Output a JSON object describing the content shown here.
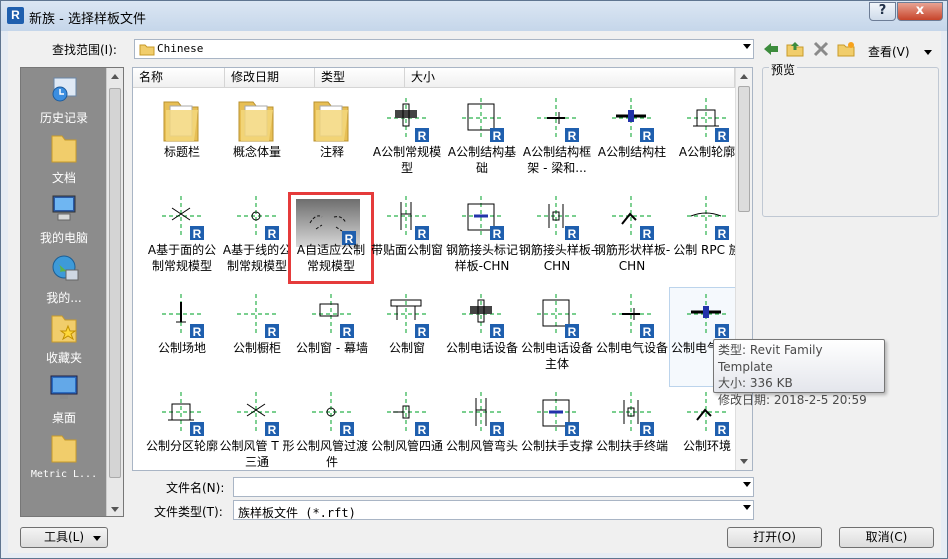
{
  "window": {
    "title": "新族 - 选择样板文件",
    "app_icon": "R",
    "help_label": "?",
    "close_label": "x"
  },
  "lookin": {
    "label": "查找范围(I):",
    "value": "Chinese"
  },
  "toolbar": {
    "views_label": "查看(V)",
    "back_icon": "back-arrow-icon",
    "up_icon": "up-folder-icon",
    "delete_icon": "delete-icon",
    "newfolder_icon": "new-folder-icon"
  },
  "sidebar": {
    "items": [
      {
        "label": "历史记录",
        "icon": "history-icon"
      },
      {
        "label": "文档",
        "icon": "documents-icon"
      },
      {
        "label": "我的电脑",
        "icon": "my-computer-icon"
      },
      {
        "label": "我的...",
        "icon": "network-icon"
      },
      {
        "label": "收藏夹",
        "icon": "favorites-icon"
      },
      {
        "label": "桌面",
        "icon": "desktop-icon"
      },
      {
        "label": "Metric L...",
        "icon": "folder-icon"
      }
    ]
  },
  "columns": [
    "名称",
    "修改日期",
    "类型",
    "大小"
  ],
  "files": [
    {
      "name": "标题栏",
      "kind": "folder"
    },
    {
      "name": "概念体量",
      "kind": "folder"
    },
    {
      "name": "注释",
      "kind": "folder"
    },
    {
      "name": "A公制常规模型",
      "kind": "rft"
    },
    {
      "name": "A公制结构基础",
      "kind": "rft"
    },
    {
      "name": "A公制结构框架 - 梁和...",
      "kind": "rft"
    },
    {
      "name": "A公制结构柱",
      "kind": "rft"
    },
    {
      "name": "A公制轮廓",
      "kind": "rft"
    },
    {
      "name": "A基于面的公制常规模型",
      "kind": "rft"
    },
    {
      "name": "A基于线的公制常规模型",
      "kind": "rft"
    },
    {
      "name": "A自适应公制常规模型",
      "kind": "rft",
      "selected": true
    },
    {
      "name": "带贴面公制窗",
      "kind": "rft"
    },
    {
      "name": "钢筋接头标记样板-CHN",
      "kind": "rft"
    },
    {
      "name": "钢筋接头样板-CHN",
      "kind": "rft"
    },
    {
      "name": "钢筋形状样板-CHN",
      "kind": "rft"
    },
    {
      "name": "公制 RPC 族",
      "kind": "rft"
    },
    {
      "name": "公制场地",
      "kind": "rft"
    },
    {
      "name": "公制橱柜",
      "kind": "rft"
    },
    {
      "name": "公制窗 - 幕墙",
      "kind": "rft"
    },
    {
      "name": "公制窗",
      "kind": "rft"
    },
    {
      "name": "公制电话设备",
      "kind": "rft"
    },
    {
      "name": "公制电话设备主体",
      "kind": "rft"
    },
    {
      "name": "公制电气设备",
      "kind": "rft"
    },
    {
      "name": "公制电气装置",
      "kind": "rft",
      "hovered": true
    },
    {
      "name": "公制分区轮廓",
      "kind": "rft"
    },
    {
      "name": "公制风管 T 形三通",
      "kind": "rft"
    },
    {
      "name": "公制风管过渡件",
      "kind": "rft"
    },
    {
      "name": "公制风管四通",
      "kind": "rft"
    },
    {
      "name": "公制风管弯头",
      "kind": "rft"
    },
    {
      "name": "公制扶手支撑",
      "kind": "rft"
    },
    {
      "name": "公制扶手终端",
      "kind": "rft"
    },
    {
      "name": "公制环境",
      "kind": "rft"
    }
  ],
  "preview": {
    "label": "预览"
  },
  "tooltip": {
    "type_line": "类型: Revit Family Template",
    "size_line": "大小: 336 KB",
    "date_line": "修改日期: 2018-2-5 20:59"
  },
  "filename": {
    "label": "文件名(N):",
    "value": ""
  },
  "filetype": {
    "label": "文件类型(T):",
    "value": "族样板文件 (*.rft)"
  },
  "buttons": {
    "tools": "工具(L)",
    "open": "打开(O)",
    "cancel": "取消(C)"
  },
  "colors": {
    "accent": "#1f5fae",
    "selection": "#e53b3b",
    "guide": "#2bb24c",
    "sidebar": "#8c8c8c",
    "folder": "#f1cd6b"
  }
}
